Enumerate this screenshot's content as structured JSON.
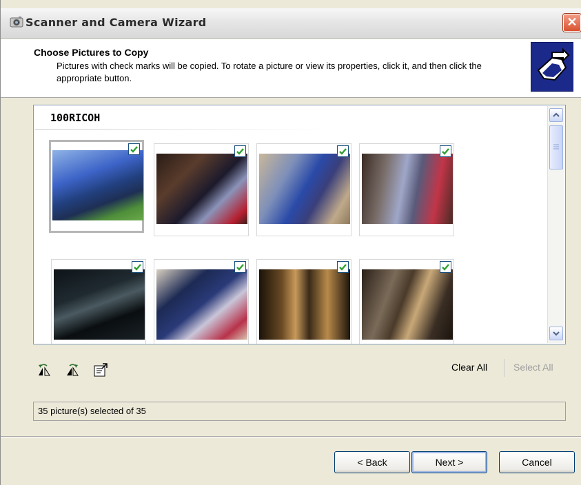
{
  "window": {
    "title": "Scanner and Camera Wizard",
    "close_label": "✕"
  },
  "header": {
    "title": "Choose Pictures to Copy",
    "subtitle": "Pictures with check marks will be copied. To rotate a picture or view its properties, click it, and then click the appropriate button."
  },
  "list": {
    "folder": "100RICOH",
    "thumbnails": [
      {
        "checked": true,
        "selected": true
      },
      {
        "checked": true,
        "selected": false
      },
      {
        "checked": true,
        "selected": false
      },
      {
        "checked": true,
        "selected": false
      },
      {
        "checked": true,
        "selected": false
      },
      {
        "checked": true,
        "selected": false
      },
      {
        "checked": true,
        "selected": false
      },
      {
        "checked": true,
        "selected": false
      }
    ]
  },
  "toolbar": {
    "icons": [
      "rotate-left-icon",
      "rotate-right-icon",
      "properties-icon"
    ],
    "clear_all": "Clear All",
    "select_all": "Select All"
  },
  "status": {
    "text": "35 picture(s) selected of 35"
  },
  "buttons": {
    "back": "< Back",
    "next": "Next >",
    "cancel": "Cancel"
  },
  "colors": {
    "accent_border": "#003c74",
    "check_green": "#2ea02e",
    "disabled_text": "#a0a0a0"
  }
}
